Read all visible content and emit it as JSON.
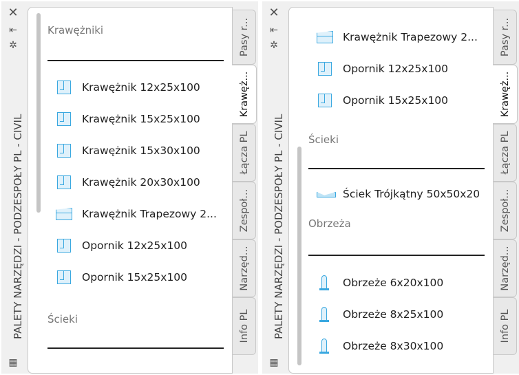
{
  "palette_title": "PALETY NARZĘDZI - PODZESPOŁY PL - CIVIL",
  "icons": {
    "close": "close-icon",
    "pin": "pin-icon",
    "settings": "gear-icon",
    "menu": "properties-icon"
  },
  "tabs": [
    "Pasy r...",
    "Krawęż...",
    "Łącza PL",
    "Zespoł...",
    "Narzęd...",
    "Info PL"
  ],
  "active_tab": "Krawęż...",
  "left_panel": {
    "section1": "Krawężniki",
    "items": [
      "Krawężnik 12x25x100",
      "Krawężnik 15x25x100",
      "Krawężnik 15x30x100",
      "Krawężnik 20x30x100",
      "Krawężnik  Trapezowy 2...",
      "Opornik 12x25x100",
      "Opornik 15x25x100"
    ],
    "section2": "Ścieki"
  },
  "right_panel": {
    "items_top": [
      "Krawężnik  Trapezowy 2...",
      "Opornik 12x25x100",
      "Opornik 15x25x100"
    ],
    "section_scieki": "Ścieki",
    "scieki_items": [
      "Ściek Trójkątny 50x50x20"
    ],
    "section_obrzeza": "Obrzeża",
    "obrzeza_items": [
      "Obrzeże 6x20x100",
      "Obrzeże 8x25x100",
      "Obrzeże 8x30x100"
    ]
  }
}
